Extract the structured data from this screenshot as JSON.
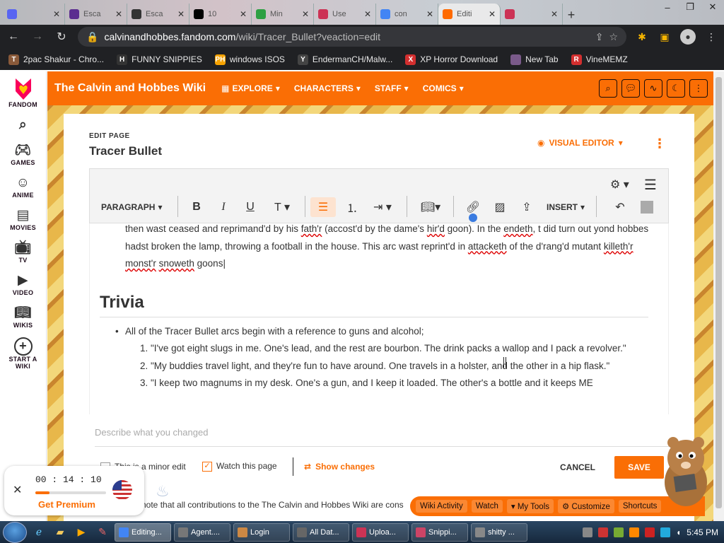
{
  "browser": {
    "tabs": [
      {
        "title": "",
        "color": "#5865f2"
      },
      {
        "title": "Esca",
        "color": "#5b2d90"
      },
      {
        "title": "Esca",
        "color": "#333333"
      },
      {
        "title": "10",
        "color": "#000000"
      },
      {
        "title": "Min",
        "color": "#2ea043"
      },
      {
        "title": "Use",
        "color": "#cc3355"
      },
      {
        "title": "con",
        "color": "#4285f4"
      },
      {
        "title": "Editi",
        "color": "#ff6a00"
      },
      {
        "title": "",
        "color": "#cc3355"
      }
    ],
    "url_domain": "calvinandhobbes.fandom.com",
    "url_path": "/wiki/Tracer_Bullet?veaction=edit",
    "bookmarks": [
      {
        "label": "2pac Shakur - Chro...",
        "icon": "T",
        "color": "#8a5a3a"
      },
      {
        "label": "FUNNY SNIPPIES",
        "icon": "H",
        "color": "#333333"
      },
      {
        "label": "windows ISOS",
        "icon": "PH",
        "color": "#f7a300"
      },
      {
        "label": "EndermanCH/Malw...",
        "icon": "Y",
        "color": "#444444"
      },
      {
        "label": "XP Horror Download",
        "icon": "X",
        "color": "#d32f2f"
      },
      {
        "label": "New Tab",
        "icon": "",
        "color": "#7a5a8a"
      },
      {
        "label": "VineMEMZ",
        "icon": "R",
        "color": "#d32f2f"
      }
    ]
  },
  "fandom_sidebar": {
    "items": [
      {
        "label": "FANDOM",
        "icon": "fandom-heart-icon"
      },
      {
        "label": "",
        "icon": "search-icon"
      },
      {
        "label": "GAMES",
        "icon": "games-icon"
      },
      {
        "label": "ANIME",
        "icon": "anime-icon"
      },
      {
        "label": "MOVIES",
        "icon": "movies-icon"
      },
      {
        "label": "TV",
        "icon": "tv-icon"
      },
      {
        "label": "VIDEO",
        "icon": "video-icon"
      },
      {
        "label": "WIKIS",
        "icon": "wikis-icon"
      },
      {
        "label": "START A WIKI",
        "icon": "plus-icon"
      }
    ]
  },
  "wiki_nav": {
    "name": "The Calvin and Hobbes Wiki",
    "menus": [
      "EXPLORE",
      "CHARACTERS",
      "STAFF",
      "COMICS"
    ]
  },
  "editor": {
    "edit_label": "EDIT PAGE",
    "page_title": "Tracer Bullet",
    "mode": "VISUAL EDITOR",
    "toolbar": {
      "paragraph": "PARAGRAPH",
      "insert": "INSERT"
    },
    "body_text": [
      {
        "t": "then wast ceased and reprimand'd by his "
      },
      {
        "t": "fath'r",
        "sq": true
      },
      {
        "t": " (accost'd by the dame's "
      },
      {
        "t": "hir'd",
        "sq": true
      },
      {
        "t": " goon).  In the "
      },
      {
        "t": "endeth",
        "sq": true
      },
      {
        "t": ", t did turn out yond hobbes hadst broken the lamp, throwing a football in the house.  This arc wast reprint'd in "
      },
      {
        "t": "attacketh",
        "sq": true
      },
      {
        "t": " of the d'rang'd mutant "
      },
      {
        "t": "killeth'r",
        "sq": true
      },
      {
        "t": " "
      },
      {
        "t": "monst'r",
        "sq": true
      },
      {
        "t": " "
      },
      {
        "t": "snoweth",
        "sq": true
      },
      {
        "t": " goons"
      }
    ],
    "trivia_heading": "Trivia",
    "trivia_intro": "All of the Tracer Bullet arcs begin with a reference to guns and alcohol;",
    "trivia_items": [
      "\"I've got eight slugs in me. One's lead, and the rest are bourbon. The drink packs a wallop and I pack a revolver.\"",
      "\"My buddies travel light, and they're fun to have around. One travels in a holster, and the other in a hip flask.\"",
      "\"I keep two magnums in my desk. One's a gun, and I keep it loaded. The other's a bottle and it keeps ME"
    ],
    "summary_placeholder": "Describe what you changed",
    "minor_edit": "This is a minor edit",
    "watch_page": "Watch this page",
    "show_changes": "Show changes",
    "cancel": "CANCEL",
    "save": "SAVE",
    "notice": "note that all contributions to the The Calvin and Hobbes Wiki are cons"
  },
  "promo": {
    "timer": "00 : 14 : 10",
    "progress": 0.2,
    "cta": "Get Premium"
  },
  "wiki_tools": [
    "Wiki Activity",
    "Watch",
    "My Tools",
    "Customize",
    "Shortcuts"
  ],
  "taskbar": {
    "tasks": [
      {
        "label": "Editing...",
        "color": "#4285f4"
      },
      {
        "label": "Agent....",
        "color": "#777777"
      },
      {
        "label": "Login",
        "color": "#cc8844"
      },
      {
        "label": "All Dat...",
        "color": "#666666"
      },
      {
        "label": "Uploa...",
        "color": "#cc3355"
      },
      {
        "label": "Snippi...",
        "color": "#cc4466"
      },
      {
        "label": "shitty ...",
        "color": "#888888"
      }
    ],
    "clock": "5:45 PM"
  },
  "colors": {
    "accent": "#fa6e05"
  }
}
